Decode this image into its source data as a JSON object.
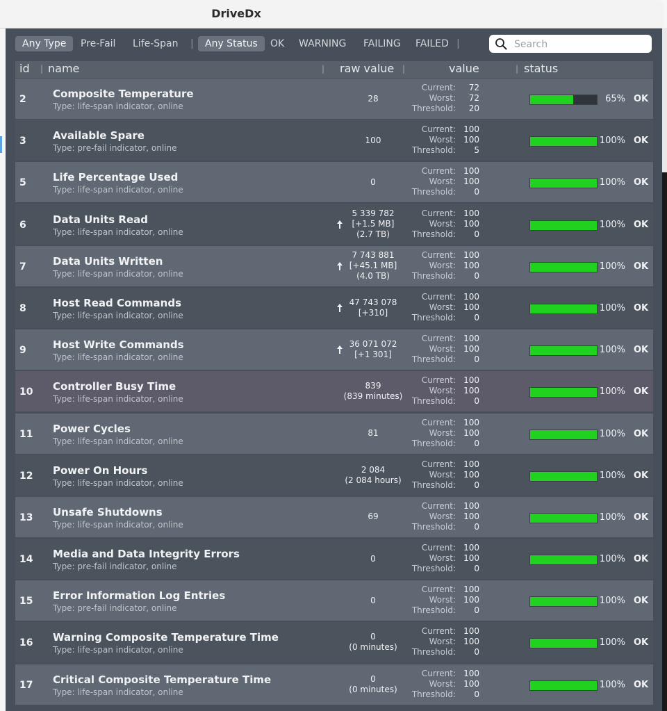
{
  "window": {
    "title": "DriveDx"
  },
  "filters": {
    "type_any": "Any Type",
    "type_prefail": "Pre-Fail",
    "type_lifespan": "Life-Span",
    "status_any": "Any Status",
    "status_ok": "OK",
    "status_warning": "WARNING",
    "status_failing": "FAILING",
    "status_failed": "FAILED",
    "separator": "|"
  },
  "search": {
    "placeholder": "Search",
    "icon": "search-icon"
  },
  "columns": {
    "id": "id",
    "name": "name",
    "raw": "raw value",
    "value": "value",
    "status": "status"
  },
  "value_labels": {
    "current": "Current:",
    "worst": "Worst:",
    "threshold": "Threshold:"
  },
  "colors": {
    "bar_fill": "#21d11f",
    "panel": "#47505a",
    "row_light": "#5f6873",
    "row_dark": "#4b535d"
  },
  "rows": [
    {
      "id": "2",
      "name": "Composite Temperature",
      "type": "Type: life-span indicator, online",
      "raw": [
        "28"
      ],
      "arrow": false,
      "current": "72",
      "worst": "72",
      "threshold": "20",
      "pct_text": "65%",
      "pct": 65,
      "status": "OK"
    },
    {
      "id": "3",
      "name": "Available Spare",
      "type": "Type: pre-fail indicator, online",
      "raw": [
        "100"
      ],
      "arrow": false,
      "current": "100",
      "worst": "100",
      "threshold": "5",
      "pct_text": "100%",
      "pct": 100,
      "status": "OK"
    },
    {
      "id": "5",
      "name": "Life Percentage Used",
      "type": "Type: life-span indicator, online",
      "raw": [
        "0"
      ],
      "arrow": false,
      "current": "100",
      "worst": "100",
      "threshold": "0",
      "pct_text": "100%",
      "pct": 100,
      "status": "OK"
    },
    {
      "id": "6",
      "name": "Data Units Read",
      "type": "Type: life-span indicator, online",
      "raw": [
        "5 339 782",
        "[+1.5 MB]",
        "(2.7 TB)"
      ],
      "arrow": true,
      "current": "100",
      "worst": "100",
      "threshold": "0",
      "pct_text": "100%",
      "pct": 100,
      "status": "OK"
    },
    {
      "id": "7",
      "name": "Data Units Written",
      "type": "Type: life-span indicator, online",
      "raw": [
        "7 743 881",
        "[+45.1 MB]",
        "(4.0 TB)"
      ],
      "arrow": true,
      "current": "100",
      "worst": "100",
      "threshold": "0",
      "pct_text": "100%",
      "pct": 100,
      "status": "OK"
    },
    {
      "id": "8",
      "name": "Host Read Commands",
      "type": "Type: life-span indicator, online",
      "raw": [
        "47 743 078",
        "[+310]"
      ],
      "arrow": true,
      "current": "100",
      "worst": "100",
      "threshold": "0",
      "pct_text": "100%",
      "pct": 100,
      "status": "OK"
    },
    {
      "id": "9",
      "name": "Host Write Commands",
      "type": "Type: life-span indicator, online",
      "raw": [
        "36 071 072",
        "[+1 301]"
      ],
      "arrow": true,
      "current": "100",
      "worst": "100",
      "threshold": "0",
      "pct_text": "100%",
      "pct": 100,
      "status": "OK"
    },
    {
      "id": "10",
      "name": "Controller Busy Time",
      "type": "Type: life-span indicator, online",
      "raw": [
        "839",
        "(839 minutes)"
      ],
      "arrow": false,
      "current": "100",
      "worst": "100",
      "threshold": "0",
      "pct_text": "100%",
      "pct": 100,
      "status": "OK"
    },
    {
      "id": "11",
      "name": "Power Cycles",
      "type": "Type: life-span indicator, online",
      "raw": [
        "81"
      ],
      "arrow": false,
      "current": "100",
      "worst": "100",
      "threshold": "0",
      "pct_text": "100%",
      "pct": 100,
      "status": "OK"
    },
    {
      "id": "12",
      "name": "Power On Hours",
      "type": "Type: life-span indicator, online",
      "raw": [
        "2 084",
        "(2 084 hours)"
      ],
      "arrow": false,
      "current": "100",
      "worst": "100",
      "threshold": "0",
      "pct_text": "100%",
      "pct": 100,
      "status": "OK"
    },
    {
      "id": "13",
      "name": "Unsafe Shutdowns",
      "type": "Type: life-span indicator, online",
      "raw": [
        "69"
      ],
      "arrow": false,
      "current": "100",
      "worst": "100",
      "threshold": "0",
      "pct_text": "100%",
      "pct": 100,
      "status": "OK"
    },
    {
      "id": "14",
      "name": "Media and Data Integrity Errors",
      "type": "Type: pre-fail indicator, online",
      "raw": [
        "0"
      ],
      "arrow": false,
      "current": "100",
      "worst": "100",
      "threshold": "0",
      "pct_text": "100%",
      "pct": 100,
      "status": "OK"
    },
    {
      "id": "15",
      "name": "Error Information Log Entries",
      "type": "Type: pre-fail indicator, online",
      "raw": [
        "0"
      ],
      "arrow": false,
      "current": "100",
      "worst": "100",
      "threshold": "0",
      "pct_text": "100%",
      "pct": 100,
      "status": "OK"
    },
    {
      "id": "16",
      "name": "Warning Composite Temperature Time",
      "type": "Type: life-span indicator, online",
      "raw": [
        "0",
        "(0 minutes)"
      ],
      "arrow": false,
      "current": "100",
      "worst": "100",
      "threshold": "0",
      "pct_text": "100%",
      "pct": 100,
      "status": "OK"
    },
    {
      "id": "17",
      "name": "Critical Composite Temperature Time",
      "type": "Type: life-span indicator, online",
      "raw": [
        "0",
        "(0 minutes)"
      ],
      "arrow": false,
      "current": "100",
      "worst": "100",
      "threshold": "0",
      "pct_text": "100%",
      "pct": 100,
      "status": "OK"
    }
  ]
}
